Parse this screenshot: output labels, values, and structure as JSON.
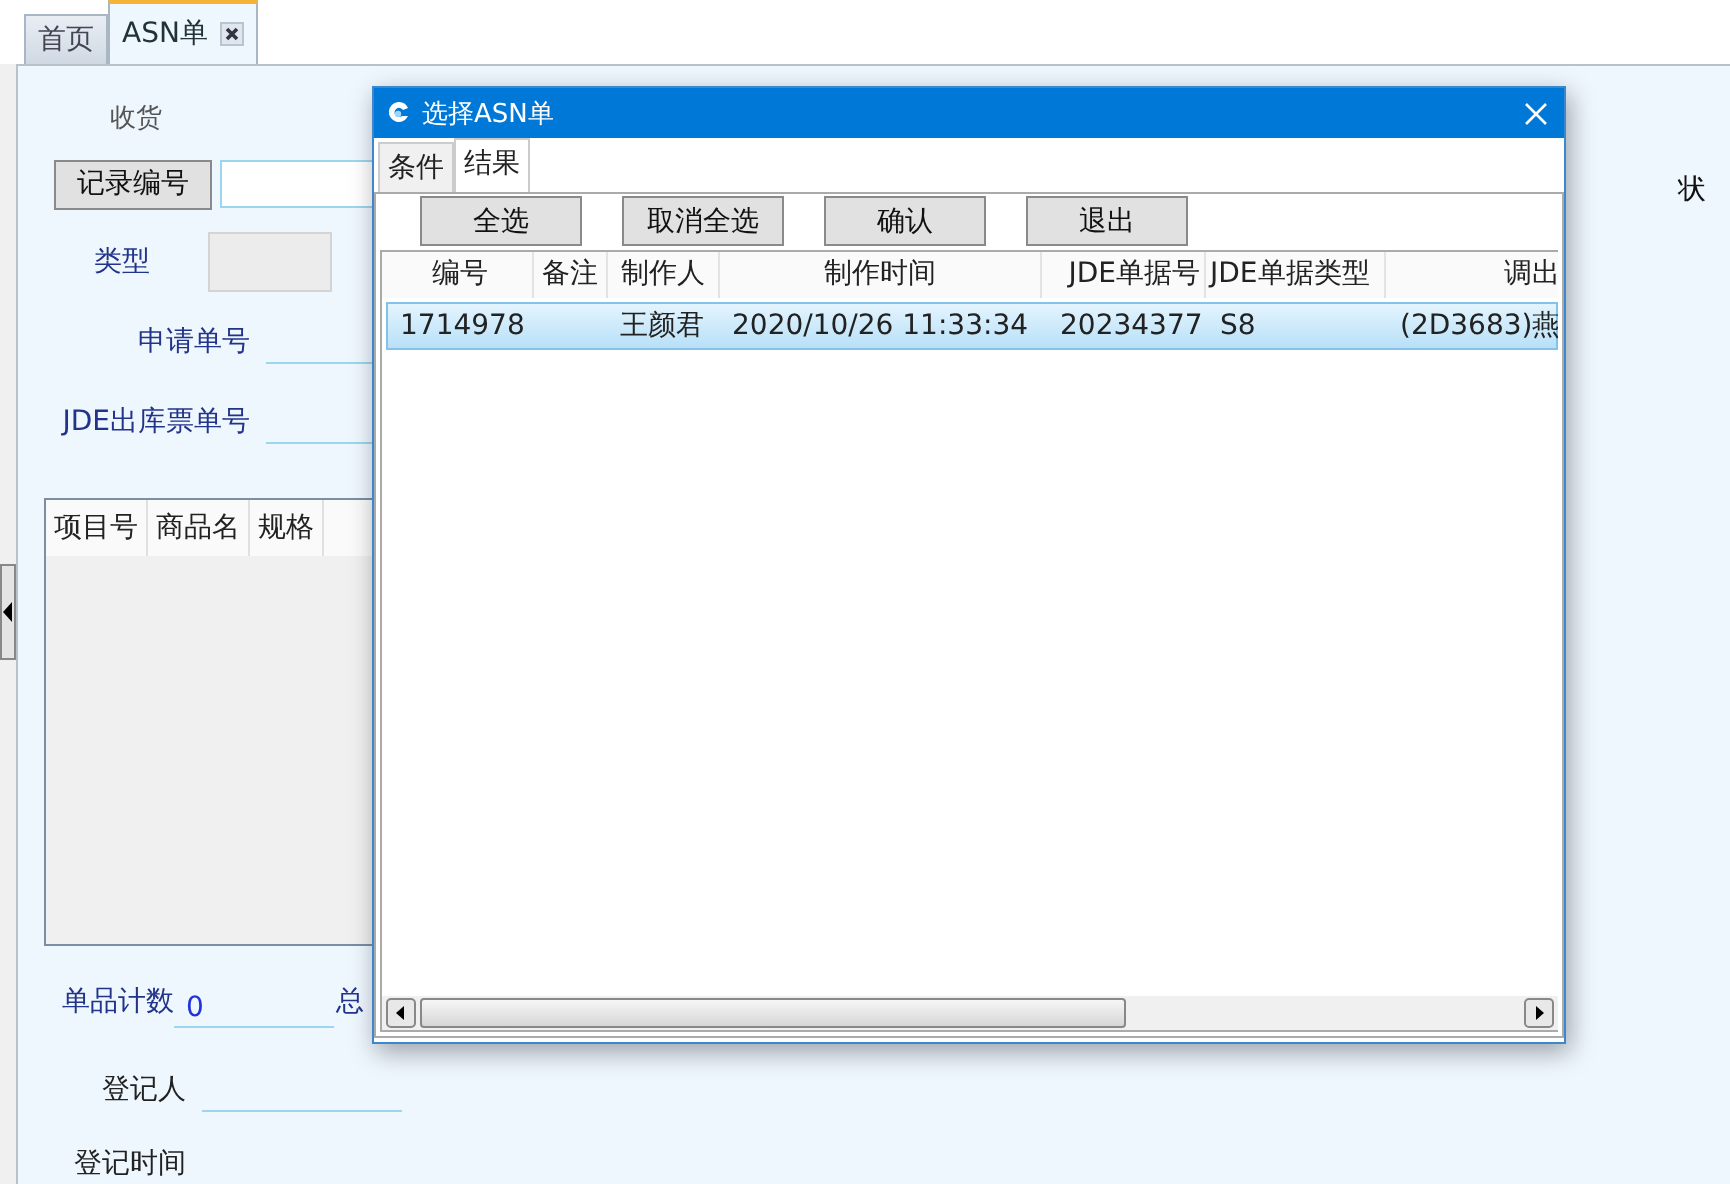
{
  "tabs": [
    {
      "label": "首页",
      "selected": false,
      "closable": false
    },
    {
      "label": "ASN单",
      "selected": true,
      "closable": true
    }
  ],
  "form": {
    "section_label": "收货",
    "record_button": "记录编号",
    "status_label": "状",
    "fields": [
      {
        "label": "类型",
        "kind": "box"
      },
      {
        "label": "申请单号",
        "kind": "line"
      },
      {
        "label": "JDE出库票单号",
        "kind": "line"
      }
    ]
  },
  "items_table": {
    "columns": [
      "项目号",
      "商品名",
      "规格"
    ]
  },
  "summary": {
    "count_label": "单品计数",
    "count_value": "0",
    "total_label": "总"
  },
  "registrar": {
    "label": "登记人"
  },
  "register_time": {
    "label": "登记时间"
  },
  "dialog": {
    "title": "选择ASN单",
    "tabs": [
      {
        "label": "条件",
        "selected": false
      },
      {
        "label": "结果",
        "selected": true
      }
    ],
    "buttons": [
      "全选",
      "取消全选",
      "确认",
      "退出"
    ],
    "columns": [
      "编号",
      "备注",
      "制作人",
      "制作时间",
      "JDE单据号",
      "JDE单据类型",
      "调出"
    ],
    "rows": [
      {
        "cells": [
          "1714978",
          "",
          "王颜君",
          "2020/10/26 11:33:34",
          "20234377",
          "S8",
          "(2D3683)燕"
        ],
        "selected": true
      }
    ]
  }
}
